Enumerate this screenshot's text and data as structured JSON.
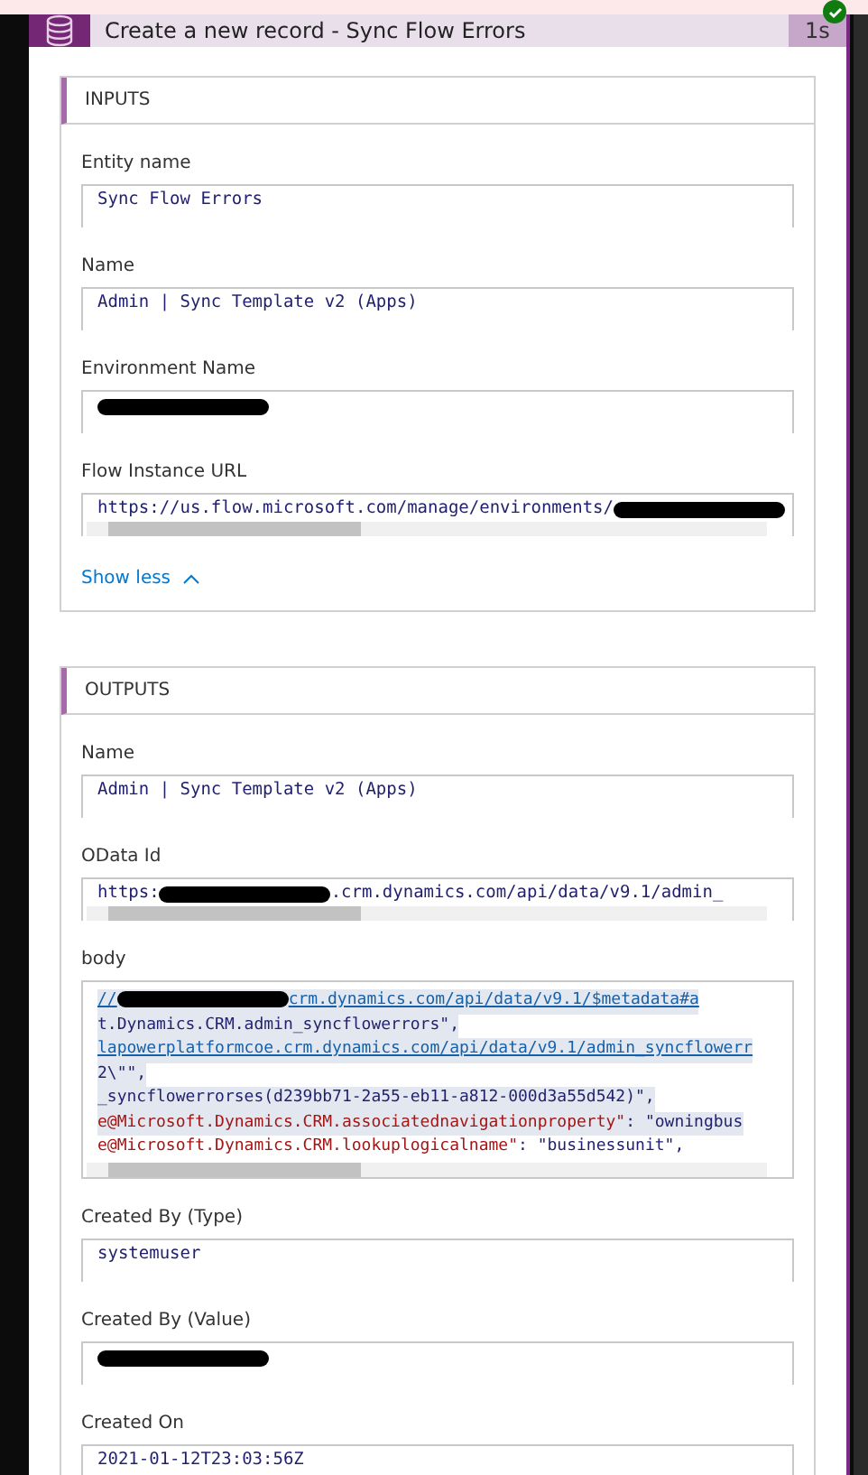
{
  "action": {
    "title": "Create a new record - Sync Flow Errors",
    "duration": "1s",
    "succeeded": true
  },
  "inputs": {
    "heading": "INPUTS",
    "fields": [
      {
        "label": "Entity name",
        "kind": "text",
        "value": [
          {
            "kind": "plain",
            "text": "Sync Flow Errors"
          }
        ]
      },
      {
        "label": "Name",
        "kind": "text",
        "value": [
          {
            "kind": "plain",
            "text": "Admin | Sync Template v2 (Apps)"
          }
        ]
      },
      {
        "label": "Environment Name",
        "kind": "text",
        "value": [
          {
            "kind": "redacted"
          }
        ]
      },
      {
        "label": "Flow Instance URL",
        "kind": "scroll",
        "value": [
          {
            "kind": "plain",
            "text": "https://us.flow.microsoft.com/manage/environments/"
          },
          {
            "kind": "redacted"
          }
        ]
      }
    ],
    "toggle": "Show less"
  },
  "outputs": {
    "heading": "OUTPUTS",
    "fields": [
      {
        "label": "Name",
        "kind": "text",
        "value": [
          {
            "kind": "plain",
            "text": "Admin | Sync Template v2 (Apps)"
          }
        ]
      },
      {
        "label": "OData Id",
        "kind": "scroll",
        "value": [
          {
            "kind": "plain",
            "text": "https:"
          },
          {
            "kind": "redacted"
          },
          {
            "kind": "plain",
            "text": ".crm.dynamics.com/api/data/v9.1/admin_"
          }
        ]
      },
      {
        "label": "body",
        "kind": "code",
        "lines": [
          {
            "selected": true,
            "segments": [
              {
                "kind": "link",
                "text": "//"
              },
              {
                "kind": "redacted"
              },
              {
                "kind": "link",
                "text": "crm.dynamics.com/api/data/v9.1/$metadata#a"
              }
            ]
          },
          {
            "selected": true,
            "segments": [
              {
                "kind": "plain",
                "text": "t.Dynamics.CRM.admin_syncflowerrors\","
              }
            ]
          },
          {
            "selected": true,
            "segments": [
              {
                "kind": "link",
                "text": "lapowerplatformcoe.crm.dynamics.com/api/data/v9.1/admin_syncflowerr"
              }
            ]
          },
          {
            "selected": true,
            "segments": [
              {
                "kind": "plain",
                "text": "2\\\"\","
              }
            ]
          },
          {
            "selected": true,
            "segments": [
              {
                "kind": "plain",
                "text": "_syncflowerrorses(d239bb71-2a55-eb11-a812-000d3a55d542)\","
              }
            ]
          },
          {
            "selected": true,
            "segments": [
              {
                "kind": "key",
                "text": "e@Microsoft.Dynamics.CRM.associatednavigationproperty\""
              },
              {
                "kind": "plain",
                "text": ": "
              },
              {
                "kind": "plain",
                "text": "\"owningbus"
              }
            ]
          },
          {
            "selected": false,
            "segments": [
              {
                "kind": "key",
                "text": "e@Microsoft.Dynamics.CRM.lookuplogicalname\""
              },
              {
                "kind": "plain",
                "text": ": "
              },
              {
                "kind": "plain",
                "text": "\"businessunit\","
              }
            ]
          }
        ]
      },
      {
        "label": "Created By (Type)",
        "kind": "text",
        "value": [
          {
            "kind": "plain",
            "text": "systemuser"
          }
        ]
      },
      {
        "label": "Created By (Value)",
        "kind": "text",
        "value": [
          {
            "kind": "redacted"
          }
        ]
      },
      {
        "label": "Created On",
        "kind": "text",
        "value": [
          {
            "kind": "plain",
            "text": "2021-01-12T23:03:56Z"
          }
        ]
      }
    ]
  }
}
